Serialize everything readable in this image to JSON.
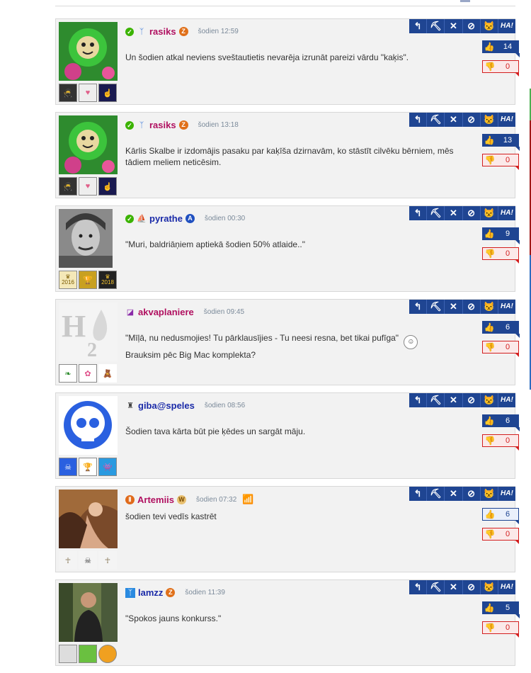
{
  "colors": {
    "toolbar": "#1f4592",
    "downvote": "#d31f1f",
    "rasiks": "#b01060",
    "pyrathe": "#1a2aa8",
    "akvaplaniere": "#b01060",
    "giba": "#1a2aa8",
    "artemiis": "#b01060",
    "lamzz": "#1a2aa8"
  },
  "toolbar": {
    "reply_icon": "↰",
    "pickaxe_icon": "⛏",
    "delete_icon": "✕",
    "ignore_icon": "⊘",
    "cat_icon": "😾",
    "ha_label": "HA!"
  },
  "posts": [
    {
      "username": "rasiks",
      "time": "šodien 12:59",
      "message": "Un šodien atkal neviens sveštautietis nevarēja izrunāt pareizi vārdu \"kaķis\".",
      "upvotes": "14",
      "downvotes": "0",
      "avatar": "green-creature",
      "level_icon": "Z",
      "badges": [
        "ninja-badge",
        "heart-bubble-badge",
        "hand-cursor-badge"
      ]
    },
    {
      "username": "rasiks",
      "time": "šodien 13:18",
      "message": "Kārlis Skalbe ir izdomājis pasaku par kaķīša dzirnavām, ko stāstīt cilvēku bērniem, mēs tādiem meliem neticēsim.",
      "upvotes": "13",
      "downvotes": "0",
      "avatar": "green-creature",
      "level_icon": "Z",
      "badges": [
        "ninja-badge",
        "heart-bubble-badge",
        "hand-cursor-badge"
      ]
    },
    {
      "username": "pyrathe",
      "time": "šodien 00:30",
      "message": "\"Muri, baldriāņiem aptiekā šodien 50% atlaide..\"",
      "upvotes": "9",
      "downvotes": "0",
      "avatar": "pirate-portrait",
      "level_icon": "A",
      "badges": [
        "crown-2016-badge",
        "trophy-badge",
        "crown-2018-badge"
      ],
      "badge_labels": [
        "2016",
        "",
        "2018"
      ]
    },
    {
      "username": "akvaplaniere",
      "time": "šodien 09:45",
      "message_before": "\"Mīļā, nu nedusmojies! Tu pārklausījies - Tu neesi resna, bet tikai pufīga\"",
      "message_after": "Brauksim pēc Big Mac komplekta?",
      "upvotes": "6",
      "downvotes": "0",
      "avatar": "h2o-logo",
      "badges": [
        "leaf-badge",
        "flowers-badge",
        "teddy-badge"
      ]
    },
    {
      "username": "giba@speles",
      "time": "šodien 08:56",
      "message": "Šodien tava kārta būt pie ķēdes un sargāt māju.",
      "upvotes": "6",
      "downvotes": "0",
      "avatar": "blue-skull",
      "badges": [
        "skull-badge",
        "trophy-badge",
        "monster-badge"
      ]
    },
    {
      "username": "Artemiis",
      "time": "šodien 07:32",
      "message": "šodien tevi vedīs kastrēt",
      "upvotes": "6",
      "downvotes": "0",
      "avatar": "angel-painting",
      "level_icon": "W",
      "badges": [
        "mummy-badge",
        "skull-hat-badge",
        "mummy-badge"
      ]
    },
    {
      "username": "lamzz",
      "time": "šodien 11:39",
      "message": "\"Spokos jauns konkurss.\"",
      "upvotes": "5",
      "downvotes": "0",
      "avatar": "man-photo",
      "level_icon": "Z",
      "badges": [
        "badge",
        "badge",
        "badge"
      ]
    }
  ]
}
